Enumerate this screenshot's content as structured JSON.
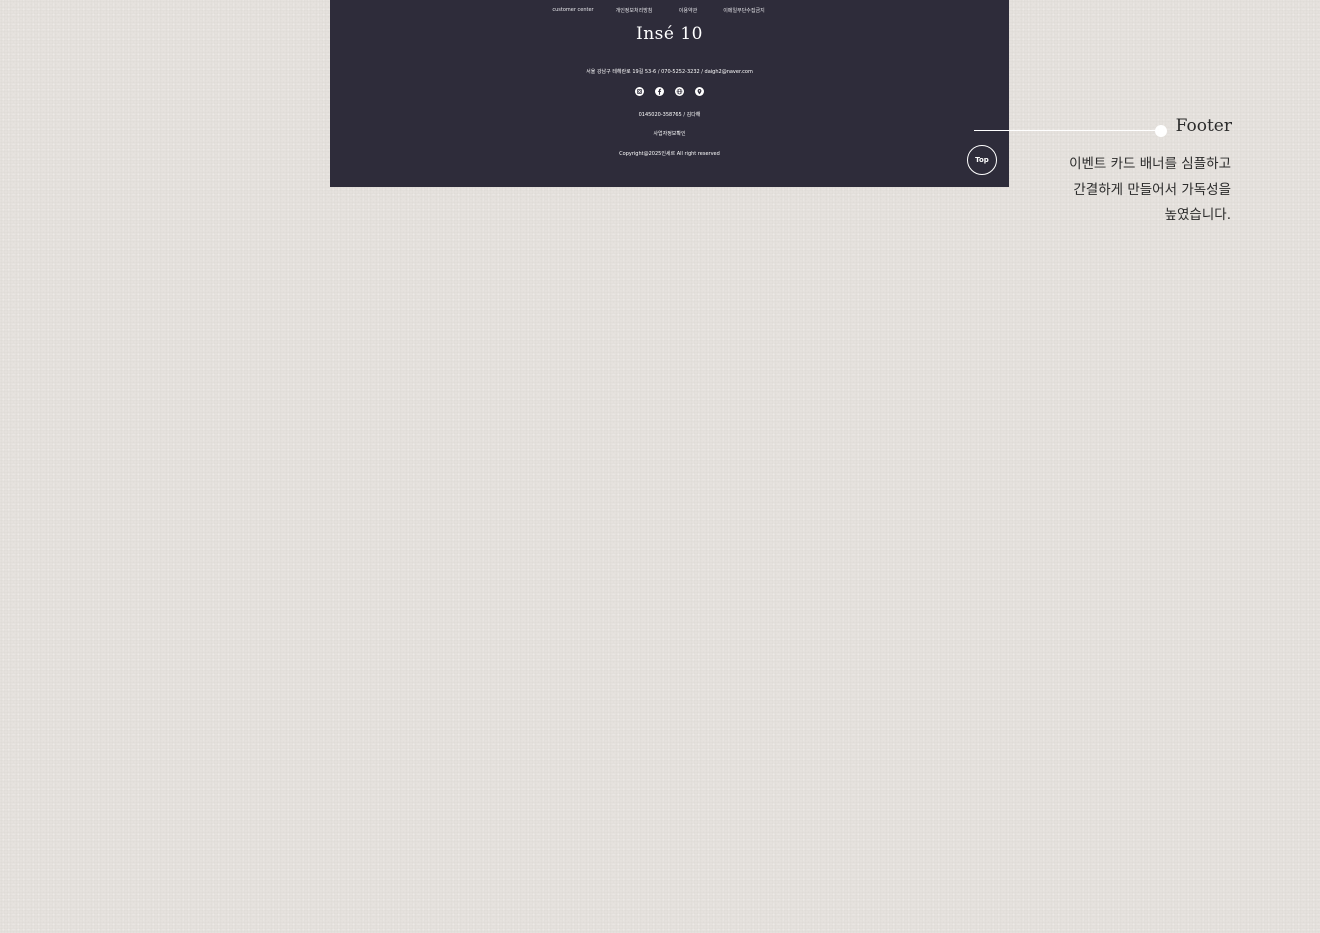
{
  "footer": {
    "nav": [
      "customer center",
      "개인정보처리방침",
      "이용약관",
      "이메일무단수집금지"
    ],
    "logo": "Insé 10",
    "address": "서울 강남구 테헤란로 19길 53-6 / 070-5252-3232 / daigh2@naver.com",
    "social_icons": [
      "instagram-icon",
      "facebook-icon",
      "globe-icon",
      "location-pin-icon"
    ],
    "business_number": "0145020-358765 / 김다해",
    "business_check": "사업자정보확인",
    "copyright": "Copyright@2025인세르 All right reserved",
    "top_button": "Top",
    "background_color": "#2e2c3a"
  },
  "annotation": {
    "title": "Footer",
    "description": [
      "이벤트 카드 배너를 심플하고",
      "간결하게 만들어서 가독성을",
      "높였습니다."
    ]
  },
  "colors": {
    "page_background": "#e5e1dd",
    "text_dark": "#2b2b2b"
  }
}
